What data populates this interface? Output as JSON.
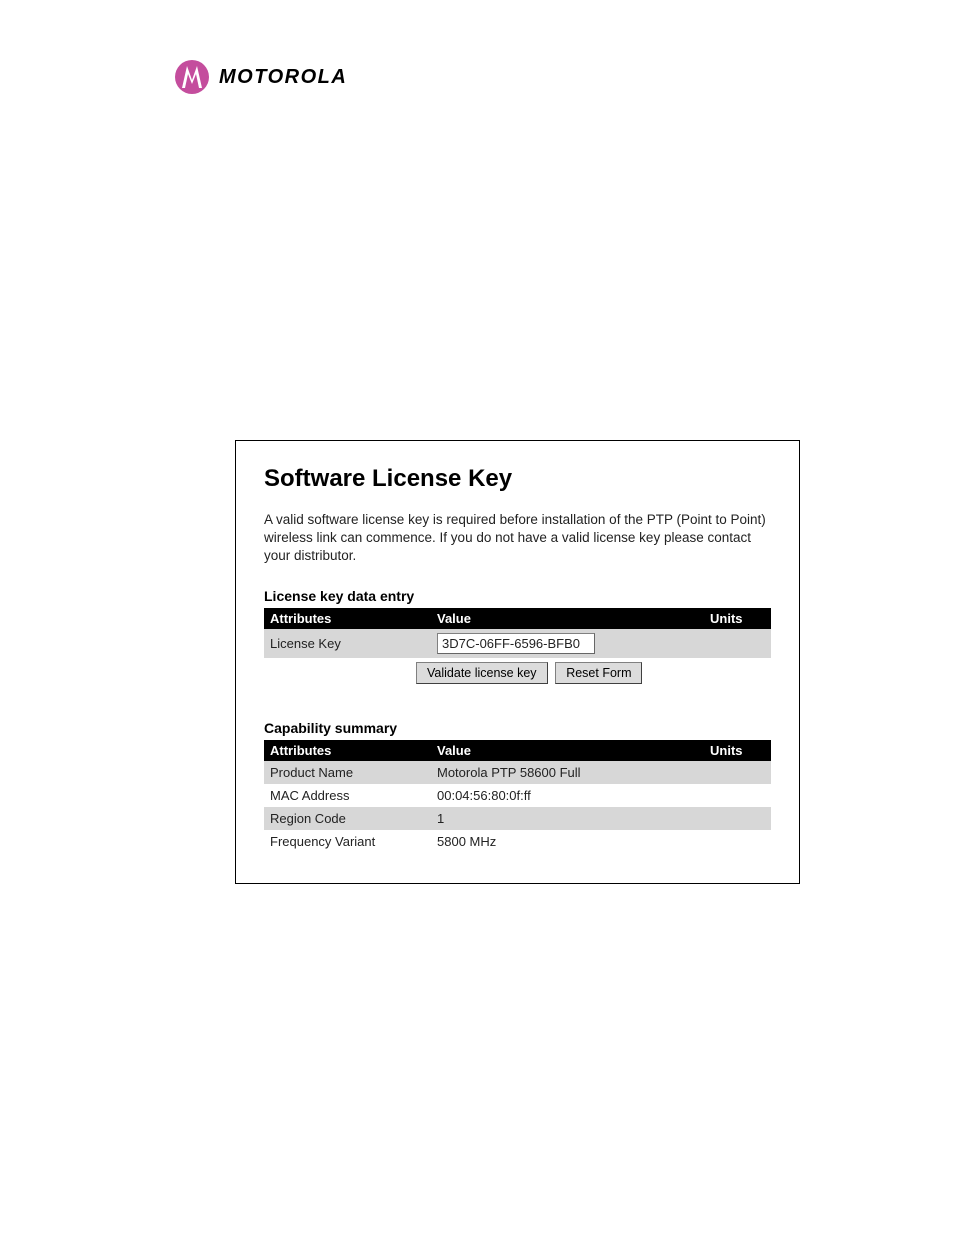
{
  "brand": {
    "name": "MOTOROLA"
  },
  "panel": {
    "title": "Software License Key",
    "intro": "A valid software license key is required before installation of the PTP (Point to Point) wireless link can commence. If you do not have a valid license key please contact your distributor.",
    "entry_section": {
      "heading": "License key data entry",
      "headers": {
        "attr": "Attributes",
        "value": "Value",
        "units": "Units"
      },
      "row_label": "License Key",
      "input_value": "3D7C-06FF-6596-BFB0",
      "validate_label": "Validate license key",
      "reset_label": "Reset Form"
    },
    "summary_section": {
      "heading": "Capability summary",
      "headers": {
        "attr": "Attributes",
        "value": "Value",
        "units": "Units"
      },
      "rows": [
        {
          "attr": "Product Name",
          "value": "Motorola PTP 58600 Full",
          "units": ""
        },
        {
          "attr": "MAC Address",
          "value": "00:04:56:80:0f:ff",
          "units": ""
        },
        {
          "attr": "Region Code",
          "value": "1",
          "units": ""
        },
        {
          "attr": "Frequency Variant",
          "value": "5800 MHz",
          "units": ""
        }
      ]
    }
  }
}
